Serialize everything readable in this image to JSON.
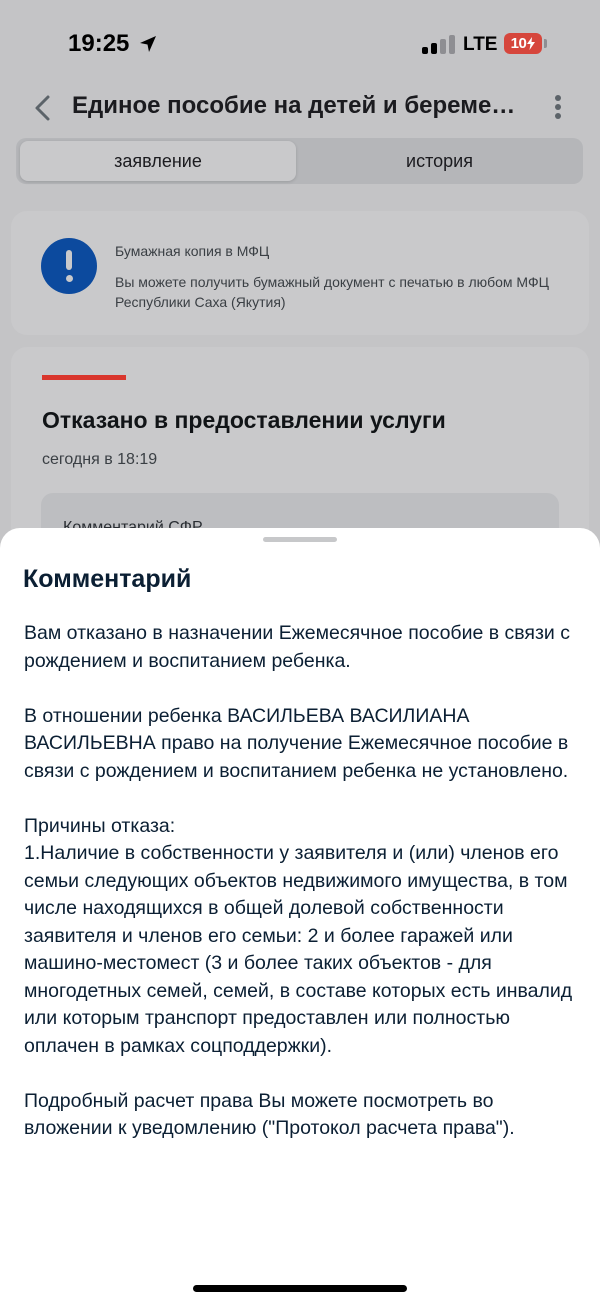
{
  "status_bar": {
    "time": "19:25",
    "location_icon": "location-arrow-icon",
    "network": "LTE",
    "battery": "10"
  },
  "header": {
    "title": "Единое пособие на детей и беременным женщинам",
    "back_icon": "chevron-left-icon",
    "more_icon": "vertical-dots-icon"
  },
  "tabs": [
    {
      "label": "заявление",
      "active": true
    },
    {
      "label": "история",
      "active": false
    }
  ],
  "notice": {
    "icon": "exclamation-circle-icon",
    "title": "Бумажная копия в МФЦ",
    "text": "Вы можете получить бумажный документ с печатью в любом МФЦ Республики Саха (Якутия)"
  },
  "status_card": {
    "title": "Отказано в предоставлении услуги",
    "date": "сегодня в 18:19",
    "comment_label": "Комментарий СФР"
  },
  "sheet": {
    "title": "Комментарий",
    "paragraphs": [
      "Вам отказано в назначении Ежемесячное пособие в связи с рождением и воспитанием ребенка.",
      "В отношении ребенка ВАСИЛЬЕВА ВАСИЛИАНА ВАСИЛЬЕВНА право на получение Ежемесячное пособие в связи с рождением и воспитанием ребенка не установлено.",
      "Причины отказа:",
      "1.Наличие в собственности у заявителя и (или) членов его семьи следующих объектов недвижимого имущества, в том числе находящихся в общей долевой собственности заявителя и членов его семьи: 2 и более гаражей или машино-местомест (3 и более таких объектов - для многодетных семей, семей, в составе которых есть инвалид или которым транспорт предоставлен или полностью оплачен в рамках соцподдержки).",
      "Подробный расчет права Вы можете посмотреть во вложении к уведомлению (\"Протокол расчета права\")."
    ]
  },
  "colors": {
    "accent_blue": "#0c4a9e",
    "error_red": "#d9362d",
    "battery_red": "#d6463c"
  }
}
